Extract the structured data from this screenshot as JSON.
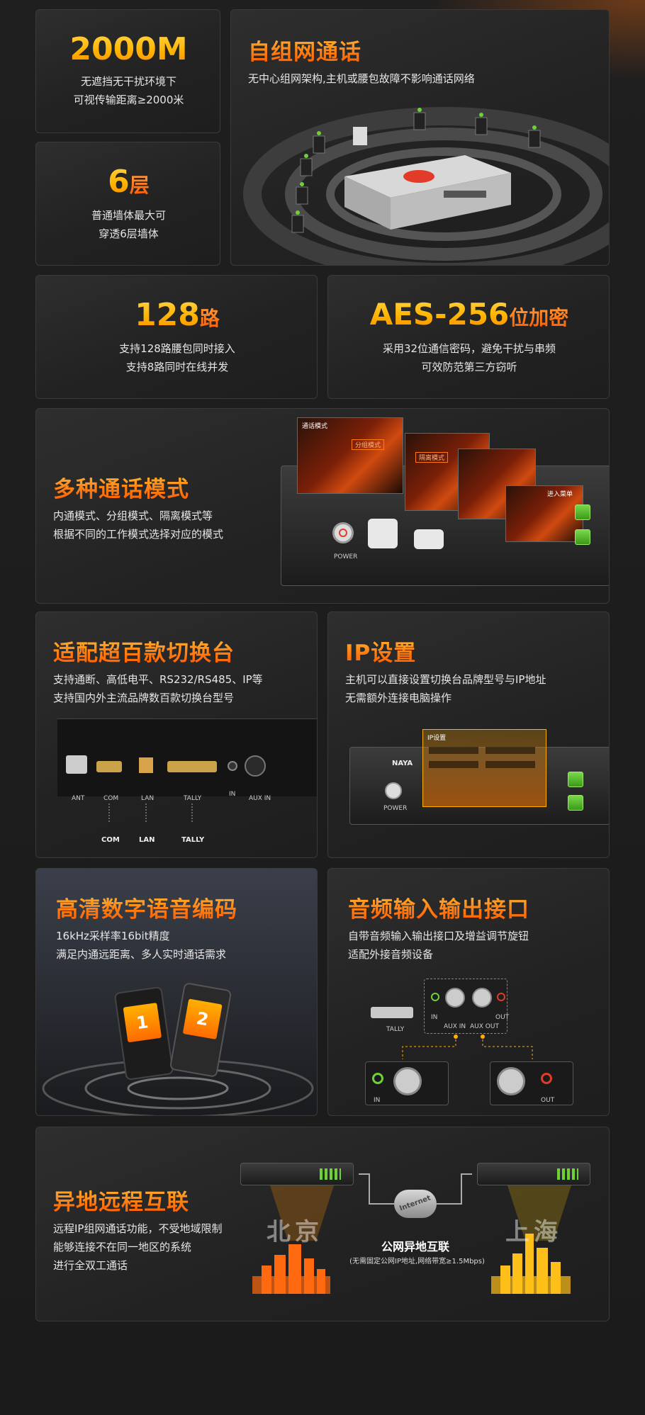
{
  "cards": {
    "distance": {
      "value": "2000M",
      "line1": "无遮挡无干扰环境下",
      "line2": "可视传输距离≥2000米"
    },
    "network": {
      "title": "自组网通话",
      "desc": "无中心组网架构,主机或腰包故障不影响通话网络"
    },
    "layers": {
      "value": "6",
      "unit": "层",
      "line1": "普通墙体最大可",
      "line2": "穿透6层墙体"
    },
    "channels": {
      "value": "128",
      "unit": "路",
      "line1": "支持128路腰包同时接入",
      "line2": "支持8路同时在线并发"
    },
    "encryption": {
      "value": "AES-256",
      "unit": "位加密",
      "line1": "采用32位通信密码，避免干扰与串频",
      "line2": "可效防范第三方窃听"
    },
    "modes": {
      "title": "多种通话模式",
      "line1": "内通模式、分组模式、隔离模式等",
      "line2": "根据不同的工作模式选择对应的模式",
      "screen_labels": {
        "mode": "通话模式",
        "group": "分组模式",
        "isolate": "隔离模式",
        "power": "POWER",
        "enter": "进入菜单"
      }
    },
    "switcher": {
      "title": "适配超百款切换台",
      "line1": "支持通断、高低电平、RS232/RS485、IP等",
      "line2": "支持国内外主流品牌数百款切换台型号",
      "ports": {
        "ant": "ANT",
        "com": "COM",
        "lan": "LAN",
        "tally": "TALLY",
        "in": "IN",
        "aux_in": "AUX IN"
      },
      "callouts": [
        "COM",
        "LAN",
        "TALLY"
      ]
    },
    "ip": {
      "title": "IP设置",
      "line1": "主机可以直接设置切换台品牌型号与IP地址",
      "line2": "无需额外连接电脑操作",
      "panel_title": "IP设置",
      "brand": "NAYA",
      "power": "POWER"
    },
    "codec": {
      "title": "高清数字语音编码",
      "line1": "16kHz采样率16bit精度",
      "line2": "满足内通远距离、多人实时通话需求",
      "ch1": "1",
      "ch2": "2"
    },
    "audio": {
      "title": "音频输入输出接口",
      "line1": "自带音频输入输出接口及增益调节旋钮",
      "line2": "适配外接音频设备",
      "labels": {
        "tally": "TALLY",
        "in": "IN",
        "aux_in": "AUX IN",
        "aux_out": "AUX OUT",
        "out": "OUT"
      }
    },
    "remote": {
      "title": "异地远程互联",
      "line1": "远程IP组网通话功能，不受地域限制",
      "line2": "能够连接不在同一地区的系统",
      "line3": "进行全双工通话",
      "city1": "北京",
      "city2": "上海",
      "cloud": "Internet",
      "net_title": "公网异地互联",
      "net_note": "(无需固定公网IP地址,网络带宽≥1.5Mbps)"
    }
  },
  "colors": {
    "accent": "#ff7a10",
    "gold": "#ffc23a",
    "green": "#6fd13a"
  }
}
